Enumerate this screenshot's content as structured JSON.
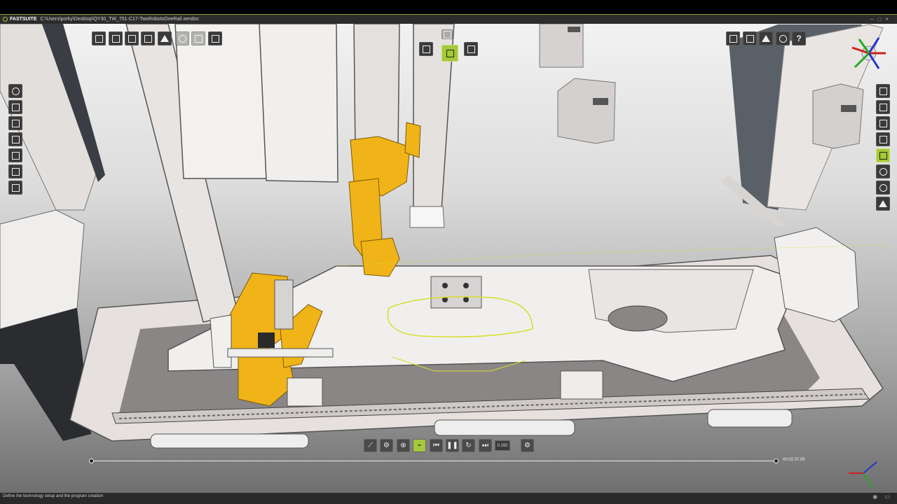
{
  "app": {
    "name": "FASTSUITE",
    "file_path": "C:\\Users\\porky\\Desktop\\QY30_TW_751-C17-TwoRobotsOneRail.xendoc"
  },
  "toolbars": {
    "top_left": [
      "open-icon",
      "save-icon",
      "document-icon",
      "export-icon",
      "hierarchy-icon",
      "link-icon",
      "grid-icon",
      "pen-icon"
    ],
    "top_center": [
      "layout-icon",
      "program-icon",
      "robot-program-icon",
      "chart-icon"
    ],
    "top_right": [
      "layout-grid-icon",
      "cube-icon",
      "layers-icon",
      "settings-icon",
      "help-icon"
    ],
    "help_label": "?",
    "left_side": [
      "select-icon",
      "move-icon",
      "measure-icon",
      "snap-icon",
      "table-icon",
      "report-icon",
      "exit-icon"
    ],
    "right_side": [
      "properties-icon",
      "library-icon",
      "catalog-icon",
      "inspector-icon",
      "axis-icon",
      "visibility-icon",
      "settings-icon",
      "markers-icon"
    ]
  },
  "playback": {
    "speed_value": "0.150",
    "time": "00:02:37.95",
    "progress_fraction": 1.0
  },
  "status": {
    "message": "Define the technology setup and the program creation"
  },
  "colors": {
    "accent": "#a5c83c",
    "robot": "#f0b418",
    "frame": "#e6e1df",
    "titlebar": "#2c2c2c"
  }
}
